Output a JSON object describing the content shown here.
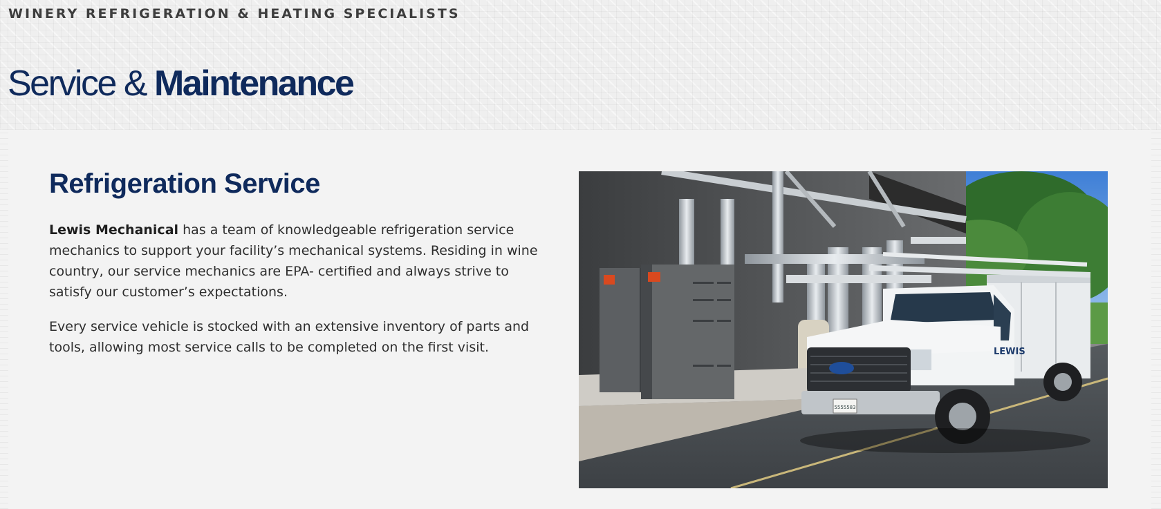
{
  "header": {
    "tagline": "WINERY REFRIGERATION & HEATING SPECIALISTS",
    "title_light": "Service & ",
    "title_bold": "Maintenance"
  },
  "section": {
    "title": "Refrigeration Service",
    "paragraph1_bold": "Lewis Mechanical",
    "paragraph1_rest": " has a team of knowledgeable refrigeration service mechanics to support your facility’s mechanical systems. Residing in wine country, our service mechanics are EPA- certified and always strive to satisfy our customer’s expectations.",
    "paragraph2": "Every service vehicle is stocked with an extensive inventory of parts and tools, allowing most service calls to be completed on the first visit."
  },
  "photo": {
    "truck_brand": "LEWIS",
    "license_plate": "5555583"
  },
  "colors": {
    "brand_navy": "#0f2a5c",
    "background": "#f3f3f3",
    "body_text": "#2e2e2e"
  }
}
